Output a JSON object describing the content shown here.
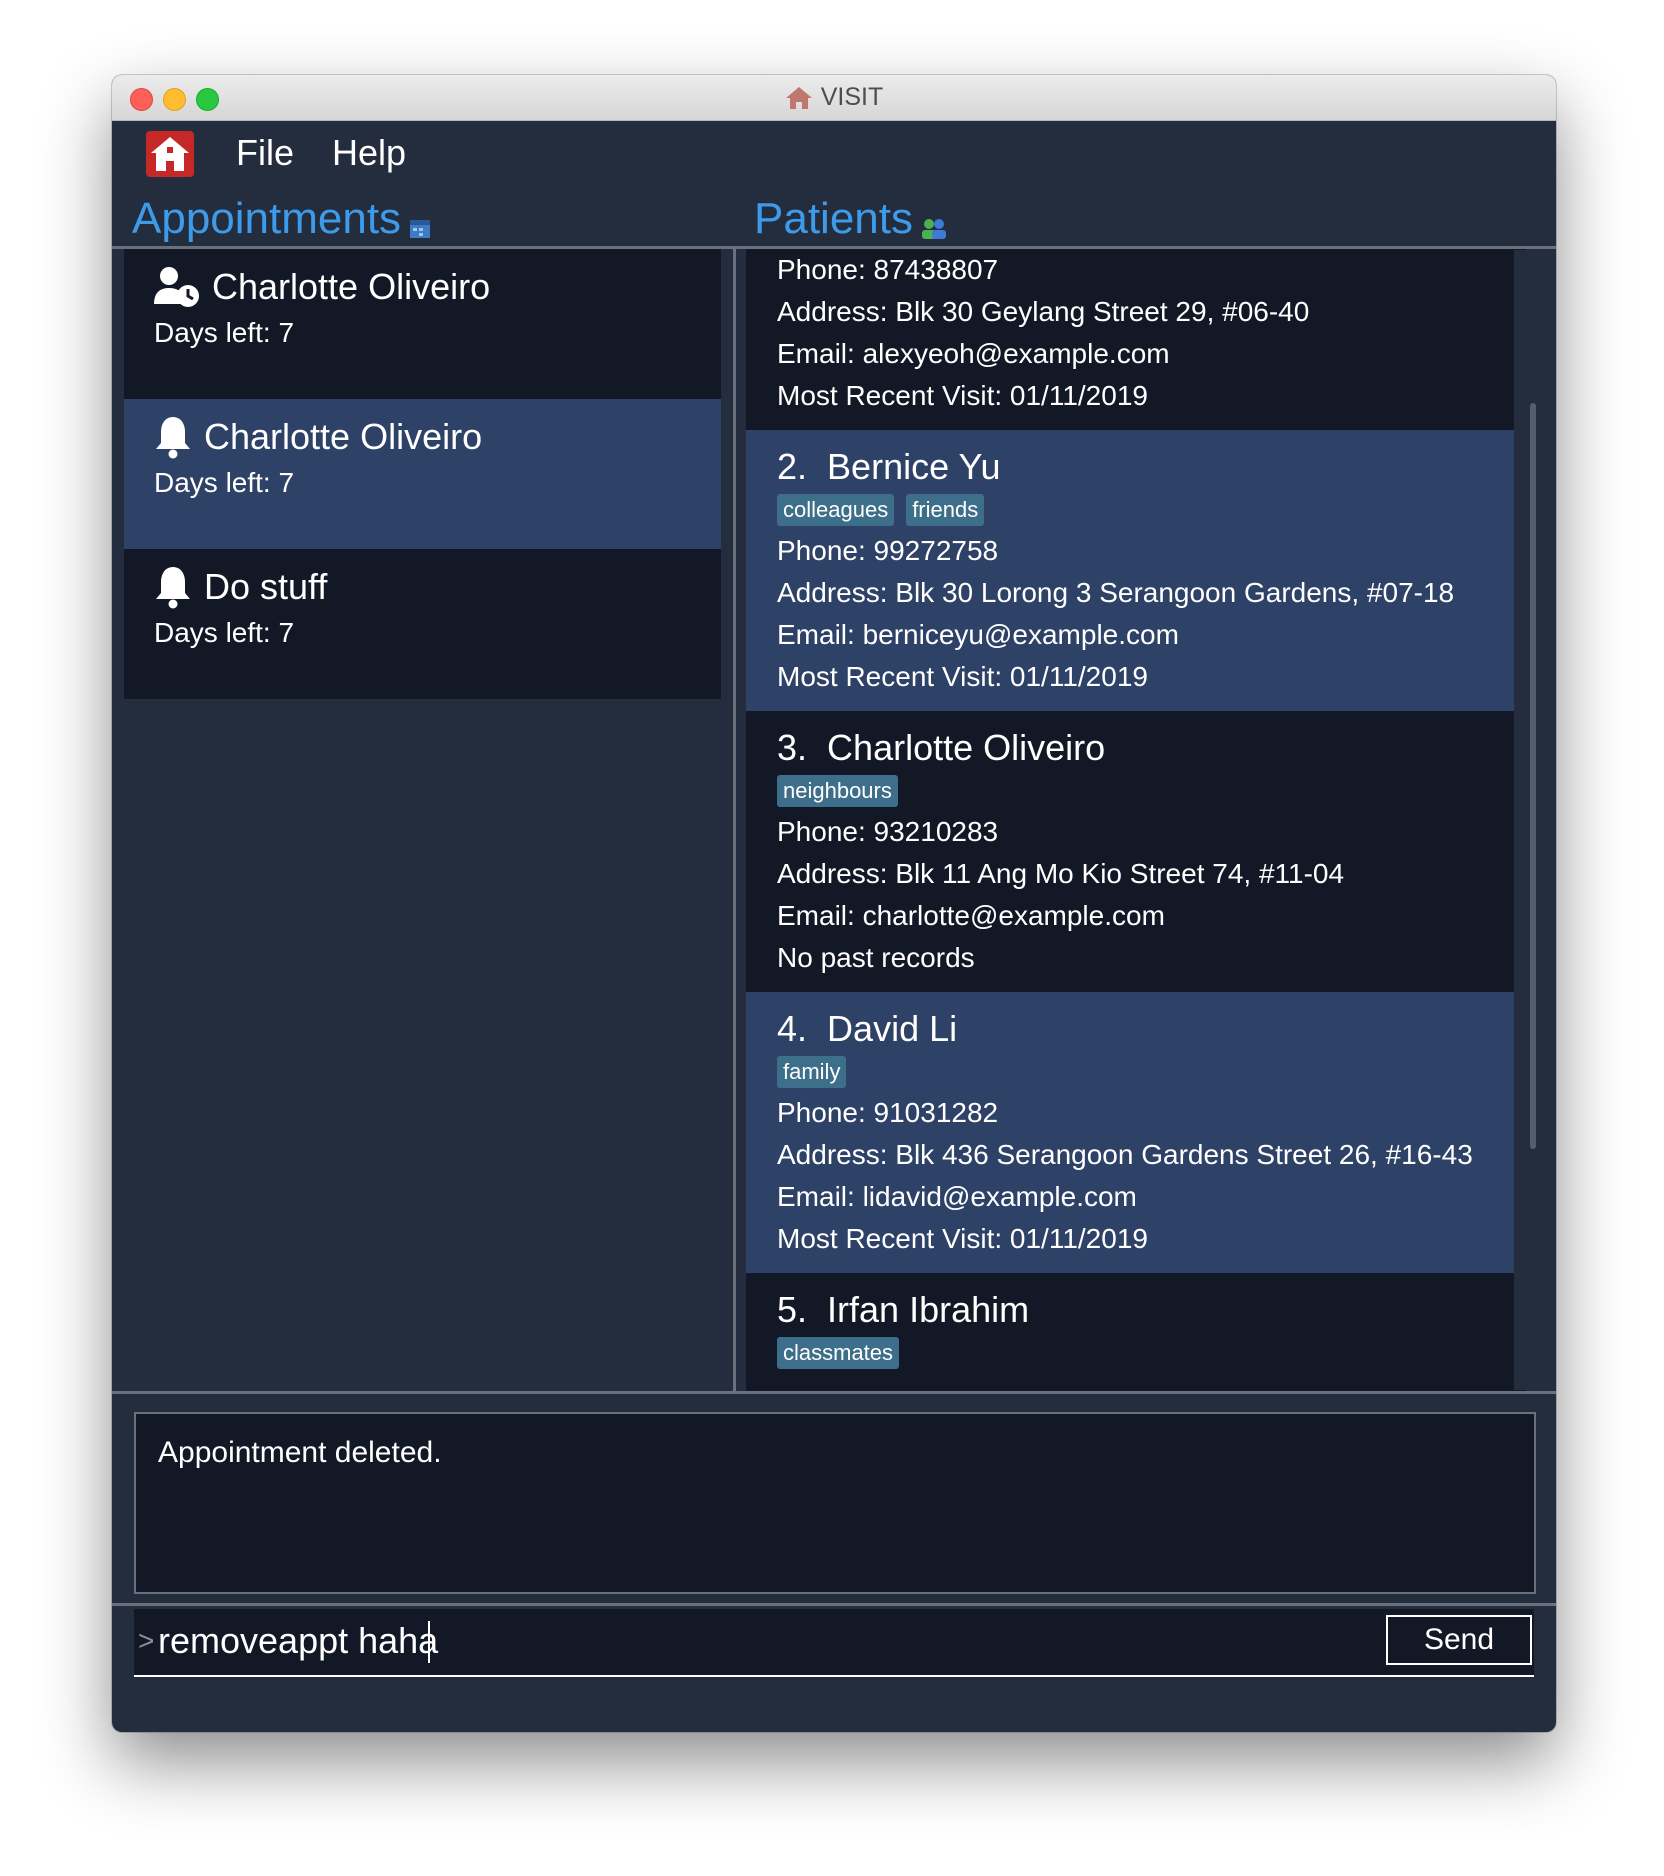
{
  "window": {
    "title": "VISIT",
    "title_icon": "house-icon"
  },
  "menu": {
    "logo_icon": "house-logo-icon",
    "file": "File",
    "help": "Help"
  },
  "sections": {
    "appointments": {
      "title": "Appointments",
      "icon": "calendar-icon"
    },
    "patients": {
      "title": "Patients",
      "icon": "people-icon"
    }
  },
  "appointments": [
    {
      "icon": "user-clock-icon",
      "name": "Charlotte Oliveiro",
      "days": "Days left: 7"
    },
    {
      "icon": "bell-icon",
      "name": "Charlotte Oliveiro",
      "days": "Days left: 7",
      "selected": true
    },
    {
      "icon": "bell-icon",
      "name": "Do stuff",
      "days": "Days left: 7"
    }
  ],
  "patients": [
    {
      "lines": [
        "Phone: 87438807",
        "Address: Blk 30 Geylang Street 29, #06-40",
        "Email: alexyeoh@example.com",
        "Most Recent Visit: 01/11/2019"
      ]
    },
    {
      "index": "2.",
      "name": "Bernice Yu",
      "tags": [
        "colleagues",
        "friends"
      ],
      "lines": [
        "Phone: 99272758",
        "Address: Blk 30 Lorong 3 Serangoon Gardens, #07-18",
        "Email: berniceyu@example.com",
        "Most Recent Visit: 01/11/2019"
      ]
    },
    {
      "index": "3.",
      "name": "Charlotte Oliveiro",
      "tags": [
        "neighbours"
      ],
      "lines": [
        "Phone: 93210283",
        "Address: Blk 11 Ang Mo Kio Street 74, #11-04",
        "Email: charlotte@example.com",
        "No past records"
      ]
    },
    {
      "index": "4.",
      "name": "David Li",
      "tags": [
        "family"
      ],
      "lines": [
        "Phone: 91031282",
        "Address: Blk 436 Serangoon Gardens Street 26, #16-43",
        "Email: lidavid@example.com",
        "Most Recent Visit: 01/11/2019"
      ]
    },
    {
      "index": "5.",
      "name": "Irfan Ibrahim",
      "tags": [
        "classmates"
      ],
      "lines": []
    }
  ],
  "result": {
    "message": "Appointment deleted."
  },
  "command": {
    "prompt": ">",
    "value": "removeappt haha",
    "send_label": "Send"
  },
  "colors": {
    "accent": "#3d9bea",
    "panel_bg": "#232d3e",
    "card_dark": "#121826",
    "card_selected": "#2e4166",
    "tag_bg": "#3d6e8a"
  }
}
